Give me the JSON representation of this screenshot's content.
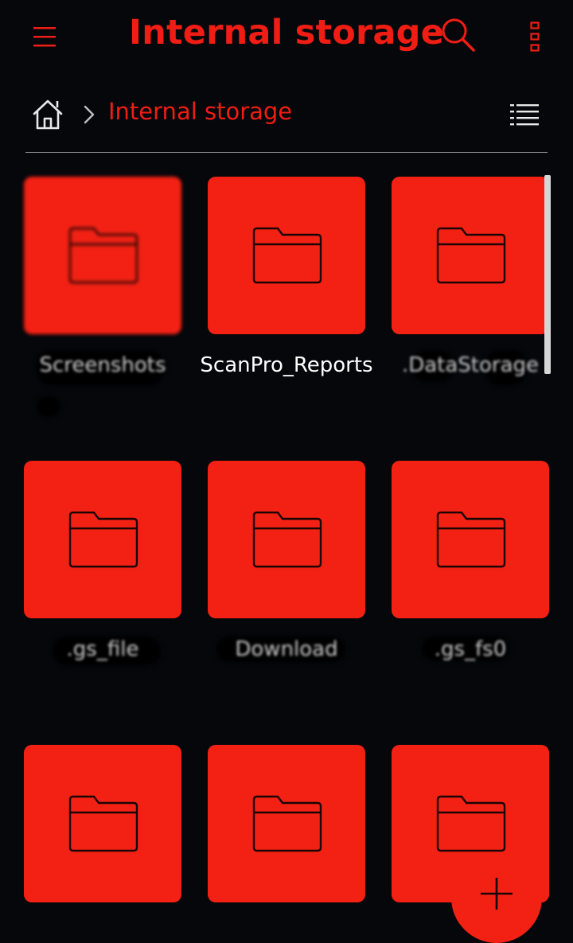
{
  "app_bar": {
    "title": "Internal storage",
    "icons": {
      "menu": "hamburger-menu-icon",
      "search": "search-icon",
      "more": "more-vertical-icon"
    }
  },
  "breadcrumb": {
    "home_icon": "home-icon",
    "separator_icon": "chevron-right-icon",
    "current": "Internal storage",
    "view_toggle_icon": "list-view-icon"
  },
  "folders": [
    {
      "name": "Screenshots",
      "redacted": true
    },
    {
      "name": "ScanPro_Reports",
      "redacted": false
    },
    {
      "name": ".DataStorage",
      "redacted": true
    },
    {
      "name": ".gs_file",
      "redacted": true
    },
    {
      "name": "Download",
      "redacted": true
    },
    {
      "name": ".gs_fs0",
      "redacted": true
    },
    {
      "name": "",
      "redacted": false
    },
    {
      "name": "",
      "redacted": false
    },
    {
      "name": "",
      "redacted": false
    }
  ],
  "fab": {
    "icon": "add-icon"
  },
  "colors": {
    "background": "#05070b",
    "accent": "#f01d14",
    "tile": "#f32114",
    "text": "#ffffff"
  }
}
